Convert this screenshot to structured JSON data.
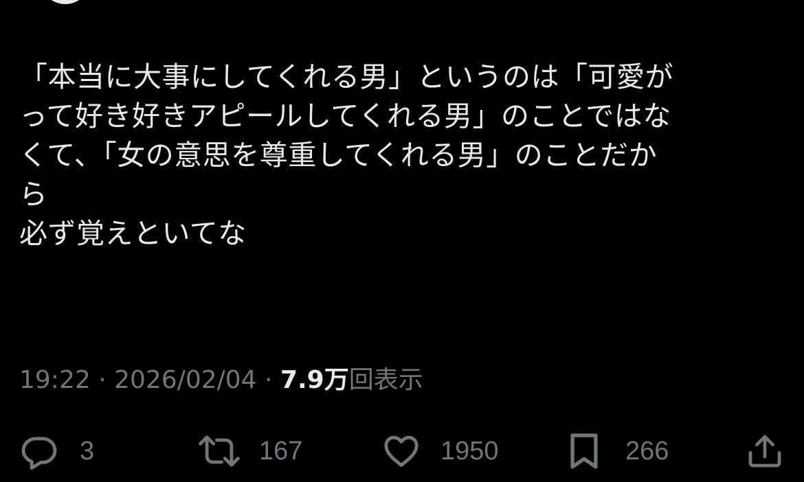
{
  "tweet": {
    "lines": [
      "「本当に大事にしてくれる男」というのは「可愛が",
      "って好き好きアピールしてくれる男」のことではな",
      "くて、「女の意思を尊重してくれる男」のことだか",
      "ら",
      "必ず覚えといてな"
    ]
  },
  "meta": {
    "time": "19:22",
    "separator": " · ",
    "date": "2026/02/04",
    "views_count": "7.9万",
    "views_label": "回表示"
  },
  "actions": {
    "reply": {
      "icon": "reply-icon",
      "count": "3"
    },
    "repost": {
      "icon": "repost-icon",
      "count": "167"
    },
    "like": {
      "icon": "heart-icon",
      "count": "1950"
    },
    "bookmark": {
      "icon": "bookmark-icon",
      "count": "266"
    },
    "share": {
      "icon": "share-icon"
    }
  },
  "colors": {
    "background": "#000000",
    "text": "#e7e9ea",
    "secondary": "#71767b"
  }
}
